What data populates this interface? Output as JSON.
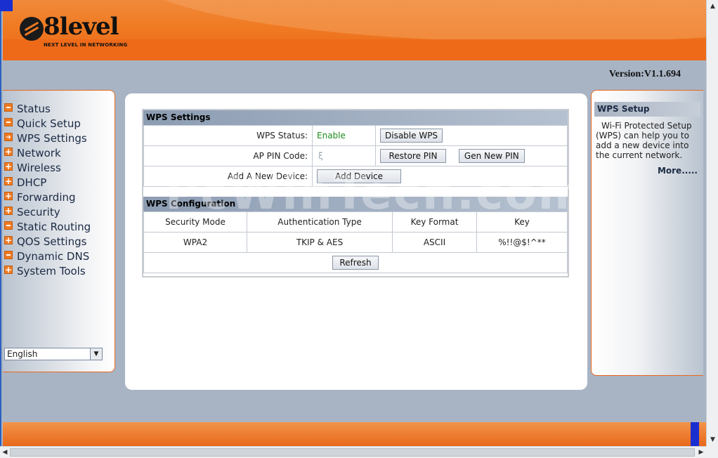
{
  "brand": {
    "logo_text": "8level",
    "tagline": "NEXT LEVEL IN NETWORKING",
    "accent": "#f07a22"
  },
  "version": "Version:V1.1.694",
  "sidebar": {
    "items": [
      {
        "label": "Status",
        "icon": "minus-icon"
      },
      {
        "label": "Quick Setup",
        "icon": "minus-icon"
      },
      {
        "label": "WPS Settings",
        "icon": "arrow-icon"
      },
      {
        "label": "Network",
        "icon": "plus-icon"
      },
      {
        "label": "Wireless",
        "icon": "plus-icon"
      },
      {
        "label": "DHCP",
        "icon": "plus-icon"
      },
      {
        "label": "Forwarding",
        "icon": "plus-icon"
      },
      {
        "label": "Security",
        "icon": "plus-icon"
      },
      {
        "label": "Static Routing",
        "icon": "minus-icon"
      },
      {
        "label": "QOS Settings",
        "icon": "plus-icon"
      },
      {
        "label": "Dynamic DNS",
        "icon": "minus-icon"
      },
      {
        "label": "System Tools",
        "icon": "plus-icon"
      }
    ],
    "language": "English"
  },
  "wps": {
    "title": "WPS Settings",
    "status_label": "WPS Status:",
    "status_value": "Enable",
    "disable_button": "Disable WPS",
    "pin_label": "AP PIN Code:",
    "pin_value": "ξ",
    "restore_button": "Restore PIN",
    "gen_button": "Gen New PIN",
    "add_label": "Add A New Device:",
    "add_button": "Add Device"
  },
  "config": {
    "title": "WPS Configuration",
    "columns": [
      "Security Mode",
      "Authentication Type",
      "Key Format",
      "Key"
    ],
    "row": [
      "WPA2",
      "TKIP & AES",
      "ASCII",
      "%!!@$!^**"
    ],
    "refresh_button": "Refresh"
  },
  "watermark": "PcWinTech.com",
  "help": {
    "title": "WPS Setup",
    "text": "Wi-Fi Protected Setup (WPS) can help you to add a new device into the current network.",
    "more": "More....."
  }
}
